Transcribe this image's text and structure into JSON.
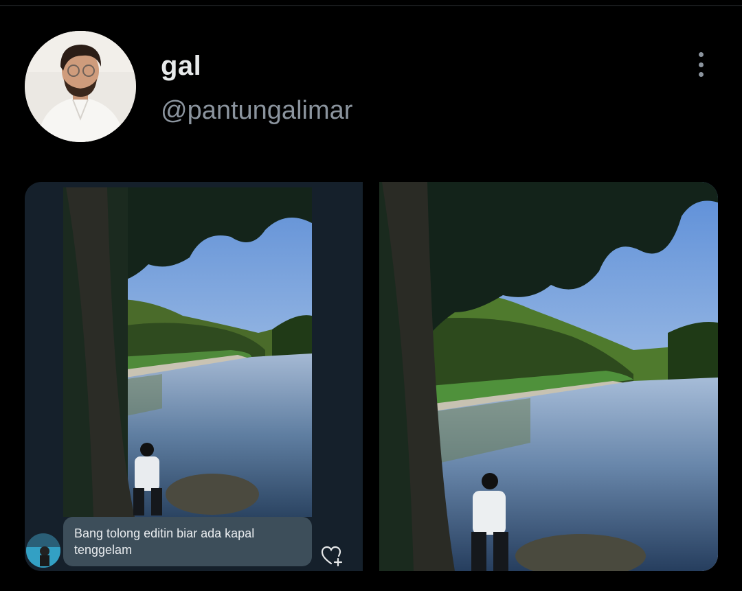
{
  "tweet": {
    "display_name": "gal",
    "handle": "@pantungalimar",
    "icons": {
      "more": "more-options-icon",
      "reaction": "heart-add-icon"
    }
  },
  "media": {
    "left_image": {
      "dm_message": "Bang tolong editin biar ada kapal tenggelam"
    }
  },
  "colors": {
    "background": "#000000",
    "secondary_text": "#8b949e",
    "dm_panel": "#15202b",
    "dm_bubble": "#3d4e5a"
  }
}
